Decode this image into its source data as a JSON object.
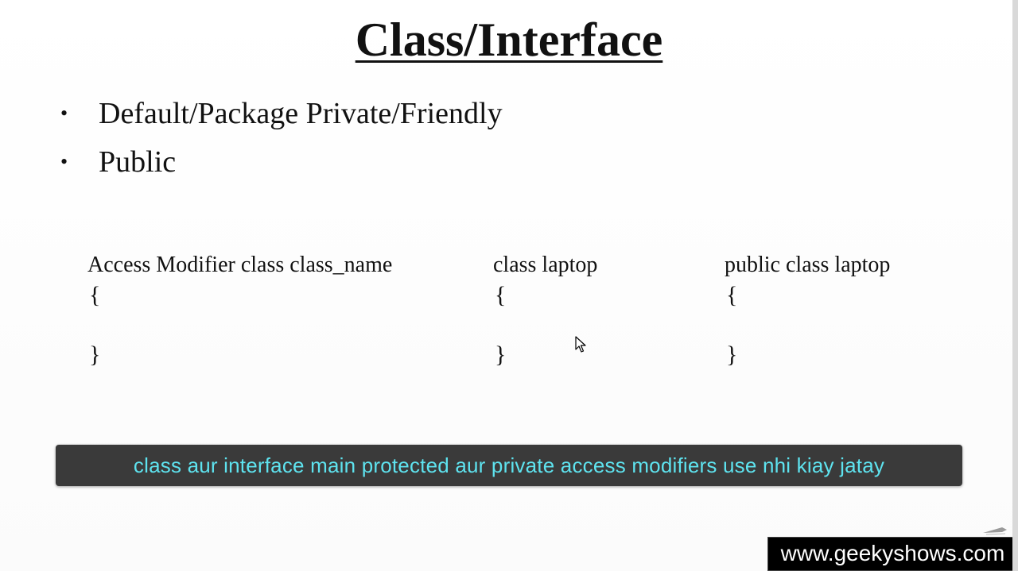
{
  "slide": {
    "title": "Class/Interface",
    "bullets": [
      {
        "label": "Default/Package Private/Friendly"
      },
      {
        "label": "Public"
      }
    ],
    "bullet_glyph": "•",
    "code_blocks": [
      {
        "heading": "Access Modifier class class_name",
        "open": "{",
        "close": "}"
      },
      {
        "heading": "class laptop",
        "open": "{",
        "close": "}"
      },
      {
        "heading": "public class laptop",
        "open": "{",
        "close": "}"
      }
    ]
  },
  "caption": {
    "text": "class aur interface main protected aur private access modifiers use nhi kiay jatay",
    "text_color": "#5ee3ef",
    "background": "#3a3a3a"
  },
  "watermark": {
    "text": "www.geekyshows.com"
  },
  "icons": {
    "cursor": "mouse-pointer-icon",
    "corner": "pen-icon"
  }
}
